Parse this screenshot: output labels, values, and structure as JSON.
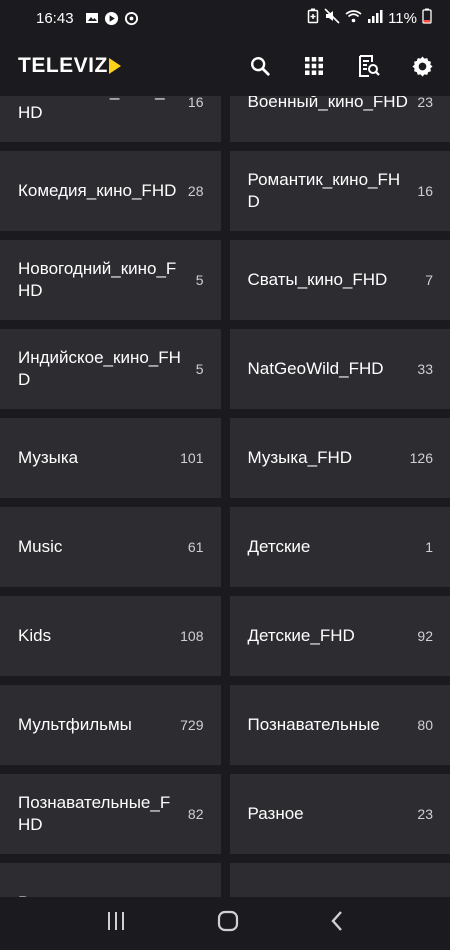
{
  "status_bar": {
    "time": "16:43",
    "battery": "11%"
  },
  "app": {
    "logo": "TELEVIZ",
    "actions": [
      "search-icon",
      "grid-icon",
      "epg-icon",
      "settings-icon"
    ]
  },
  "categories": [
    {
      "name": "Фантастика_кино_FHD",
      "count": "16"
    },
    {
      "name": "Военный_кино_FHD",
      "count": "23"
    },
    {
      "name": "Комедия_кино_FHD",
      "count": "28"
    },
    {
      "name": "Романтик_кино_FHD",
      "count": "16"
    },
    {
      "name": "Новогодний_кино_FHD",
      "count": "5"
    },
    {
      "name": "Сваты_кино_FHD",
      "count": "7"
    },
    {
      "name": "Индийское_кино_FHD",
      "count": "5"
    },
    {
      "name": "NatGeoWild_FHD",
      "count": "33"
    },
    {
      "name": "Музыка",
      "count": "101"
    },
    {
      "name": "Музыка_FHD",
      "count": "126"
    },
    {
      "name": "Music",
      "count": "61"
    },
    {
      "name": "Детские",
      "count": "1"
    },
    {
      "name": "Kids",
      "count": "108"
    },
    {
      "name": "Детские_FHD",
      "count": "92"
    },
    {
      "name": "Мультфильмы",
      "count": "729"
    },
    {
      "name": "Познавательные",
      "count": "80"
    },
    {
      "name": "Познавательные_FHD",
      "count": "82"
    },
    {
      "name": "Разное",
      "count": "23"
    },
    {
      "name": "Развлекательные",
      "count": ""
    },
    {
      "name": "",
      "count": ""
    }
  ],
  "colors": {
    "background": "#1b1b1f",
    "tile": "#2c2c31",
    "accent": "#ffd21a"
  }
}
